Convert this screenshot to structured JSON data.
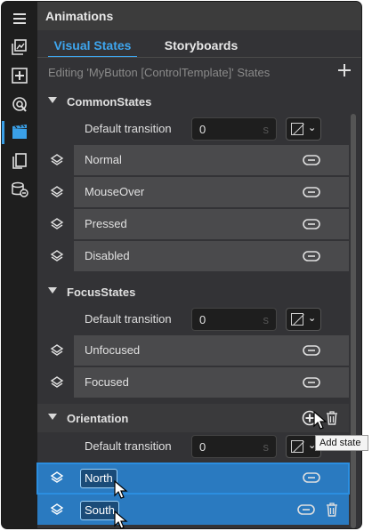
{
  "panel": {
    "title": "Animations",
    "tabs": [
      {
        "label": "Visual States",
        "active": true
      },
      {
        "label": "Storyboards",
        "active": false
      }
    ],
    "editing_text": "Editing 'MyButton [ControlTemplate]' States",
    "add_label": "+"
  },
  "activity_bar": {
    "items": [
      {
        "name": "menu-icon"
      },
      {
        "name": "assets-icon"
      },
      {
        "name": "add-element-icon"
      },
      {
        "name": "resources-icon"
      },
      {
        "name": "animations-icon",
        "active": true
      },
      {
        "name": "pages-icon"
      },
      {
        "name": "data-icon"
      }
    ]
  },
  "groups": [
    {
      "name": "CommonStates",
      "transition": {
        "label": "Default transition",
        "value": "0",
        "unit": "s"
      },
      "states": [
        "Normal",
        "MouseOver",
        "Pressed",
        "Disabled"
      ]
    },
    {
      "name": "FocusStates",
      "transition": {
        "label": "Default transition",
        "value": "0",
        "unit": "s"
      },
      "states": [
        "Unfocused",
        "Focused"
      ]
    },
    {
      "name": "Orientation",
      "transition": {
        "label": "Default transition",
        "value": "0",
        "unit": "s"
      },
      "states": [
        "North",
        "South"
      ]
    }
  ],
  "tooltip": "Add state",
  "colors": {
    "accent": "#3ea6ef",
    "selection": "#2a7ac0",
    "panel_bg": "#333336",
    "row_bg": "#4a4a4c"
  }
}
